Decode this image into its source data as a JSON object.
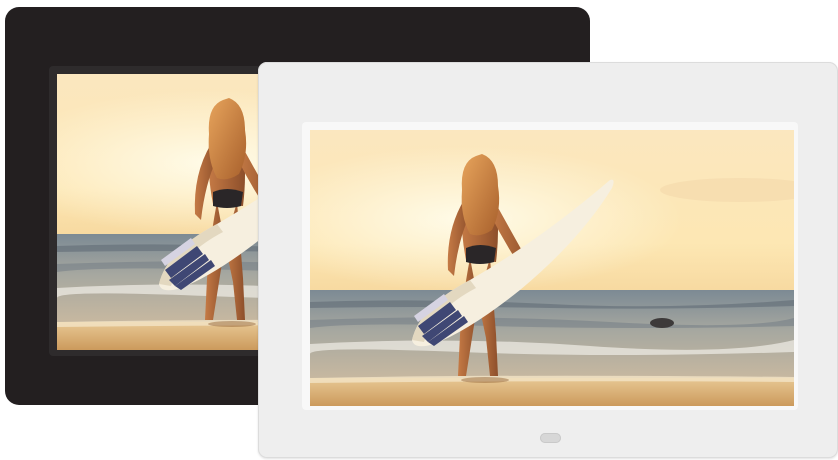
{
  "scene": {
    "frames": [
      {
        "id": "black",
        "bezel_color": "#231f20"
      },
      {
        "id": "white",
        "bezel_color": "#eeeeee"
      }
    ],
    "photo_subject": "woman-holding-surfboard-on-beach-at-sunset",
    "colors": {
      "sky": "#fde8b8",
      "sun_glow": "#fff6dc",
      "sea": "#6f7a86",
      "sand": "#d9b07a",
      "surfboard": "#f3ecdc",
      "board_stripe": "#4a4f7d"
    }
  }
}
